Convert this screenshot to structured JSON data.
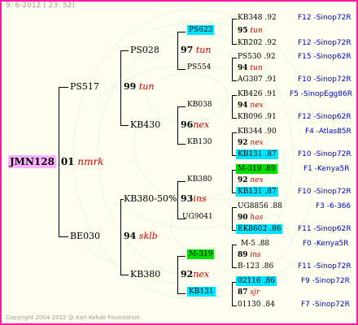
{
  "header": {
    "date": "9.  6-2012 ( 23: 52)"
  },
  "footer": {
    "copyright": "Copyright 2004-2012 @ Karl Kehde Foundation"
  },
  "colors": {
    "border": "#ff1aa6",
    "root_hl": "#ffb3ff",
    "cyan_hl": "#00e5ff",
    "green_hl": "#00dd00",
    "red_text": "#cc0000",
    "blue_text": "#0000cc"
  },
  "root": {
    "ring": "JMN128",
    "num": "01",
    "name": "nmrk"
  },
  "gen2": [
    {
      "ring": "PS517",
      "num": "99",
      "name": "tun"
    },
    {
      "ring": "BE030",
      "num": "94",
      "name": "sklb"
    }
  ],
  "gen3": [
    {
      "ring": "PS028",
      "num": "97",
      "name": "tun"
    },
    {
      "ring": "KB430",
      "num": "96",
      "name": "nex"
    },
    {
      "ring": "KB380-50%",
      "num": "93",
      "name": "ins"
    },
    {
      "ring": "KB380",
      "num": "92",
      "name": "nex"
    }
  ],
  "gen4": [
    {
      "ring": "PS623"
    },
    {
      "ring": "PS554"
    },
    {
      "ring": "KB038"
    },
    {
      "ring": "KB130"
    },
    {
      "ring": "KB380"
    },
    {
      "ring": "UG9041"
    },
    {
      "ring": "M-319"
    },
    {
      "ring": "KB131"
    }
  ],
  "gen5": [
    {
      "ring": "KB348 .92",
      "loc": "F12 -Sinop72R"
    },
    {
      "num": "95",
      "name": "tun"
    },
    {
      "ring": "KB202 .92",
      "loc": "F12 -Sinop72R"
    },
    {
      "ring": "PS530 .92",
      "loc": "F15 -Sinop62R"
    },
    {
      "num": "94",
      "name": "tun"
    },
    {
      "ring": "AG307 .91",
      "loc": "F10 -Sinop72R"
    },
    {
      "ring": "KB426 .91",
      "loc": "F5 -SinopEgg86R"
    },
    {
      "num": "94",
      "name": "nex"
    },
    {
      "ring": "KB096 .91",
      "loc": "F12 -Sinop62R"
    },
    {
      "ring": "KB344 .90",
      "loc": "F4 -Atlas85R"
    },
    {
      "num": "92",
      "name": "nex"
    },
    {
      "ring": "KB131 .87",
      "loc": "F10 -Sinop72R"
    },
    {
      "ring": "M-319 .89",
      "loc": "F1 -Kenya5R"
    },
    {
      "num": "92",
      "name": "nex"
    },
    {
      "ring": "KB131 .87",
      "loc": "F10 -Sinop72R"
    },
    {
      "ring": "UG8856 .88",
      "loc": "F3 -6-366"
    },
    {
      "num": "90",
      "name": "has"
    },
    {
      "ring": "EK8602 .86",
      "loc": "F11 -Sinop62R"
    },
    {
      "ring": "M-5 .88",
      "loc": "F0 -Kenya5R"
    },
    {
      "num": "89",
      "name": "ins"
    },
    {
      "ring": "B-123 .86",
      "loc": "F11 -Sinop72R"
    },
    {
      "ring": "02116 .86",
      "loc": "F9 -Sinop72R"
    },
    {
      "num": "87",
      "name": "sjr"
    },
    {
      "ring": "01130 .84",
      "loc": "F7 -Sinop72R"
    }
  ]
}
